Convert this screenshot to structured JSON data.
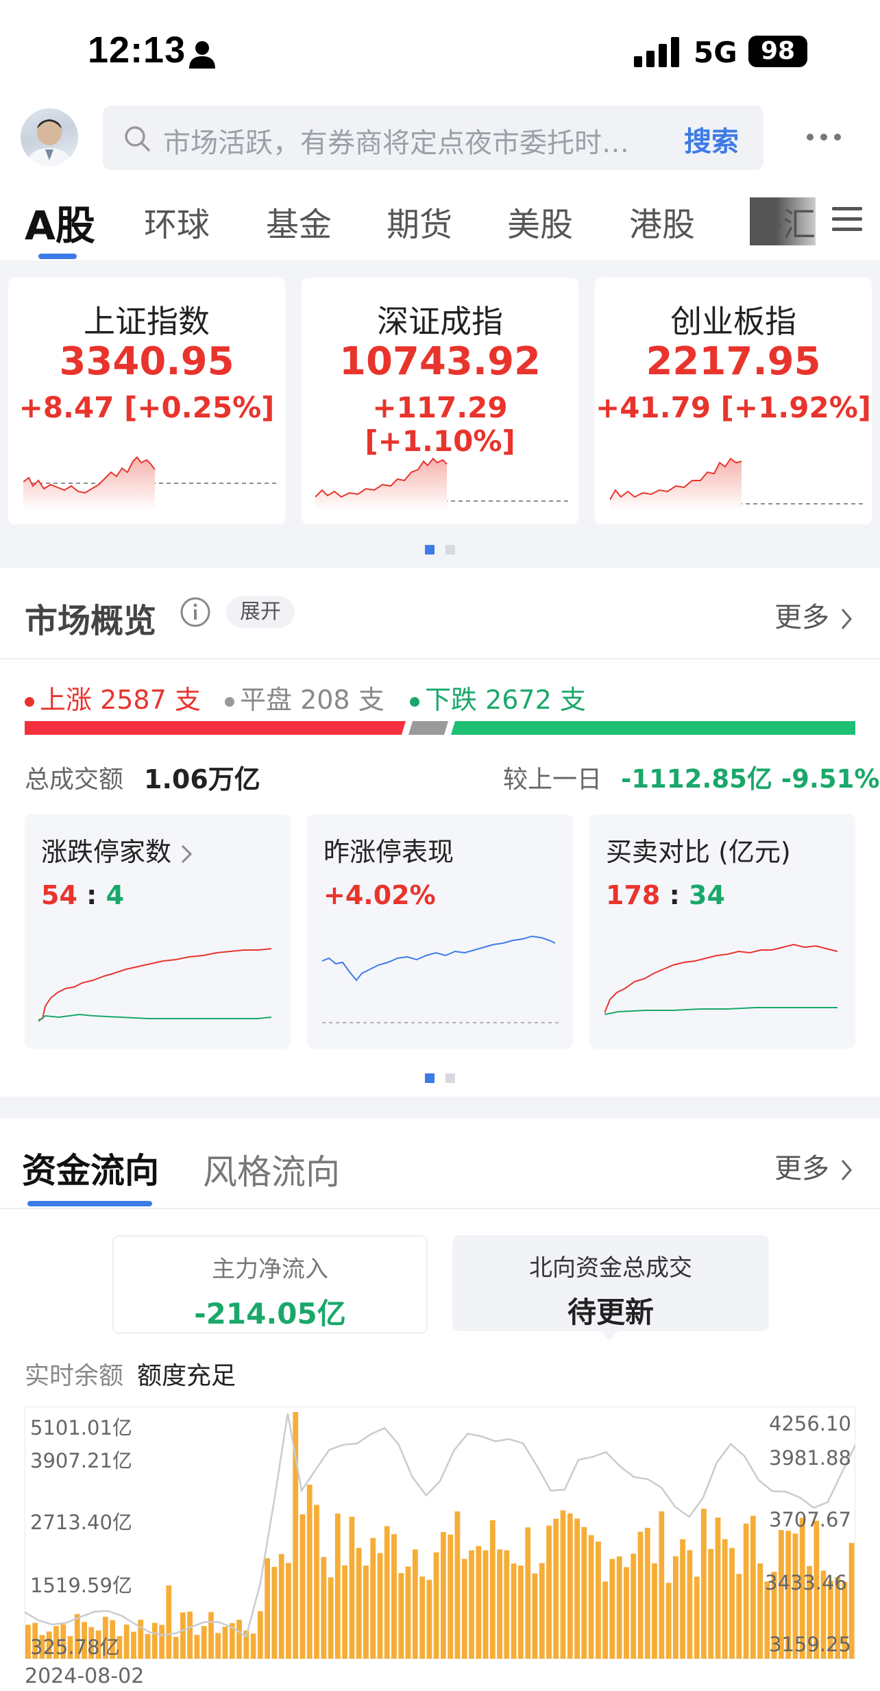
{
  "status_bar": {
    "time": "12:13",
    "network": "5G",
    "battery": "98"
  },
  "header": {
    "search_placeholder": "市场活跃，有券商将定点夜市委托时…",
    "search_button": "搜索",
    "more_icon": "ellipsis-icon"
  },
  "tabs": [
    "A股",
    "环球",
    "基金",
    "期货",
    "美股",
    "港股",
    "外汇"
  ],
  "indices": [
    {
      "name": "上证指数",
      "value": "3340.95",
      "change": "+8.47 [+0.25%]"
    },
    {
      "name": "深证成指",
      "value": "10743.92",
      "change": "+117.29 [+1.10%]"
    },
    {
      "name": "创业板指",
      "value": "2217.95",
      "change": "+41.79 [+1.92%]"
    }
  ],
  "overview": {
    "title": "市场概览",
    "expand": "展开",
    "more": "更多",
    "up_label": "上涨 2587 支",
    "flat_label": "平盘 208 支",
    "down_label": "下跌 2672 支",
    "up_count": 2587,
    "flat_count": 208,
    "down_count": 2672,
    "turnover_label": "总成交额",
    "turnover_value": "1.06万亿",
    "compare_label": "较上一日",
    "compare_value": "-1112.85亿 -9.51%",
    "mini_cards": [
      {
        "title": "涨跌停家数",
        "v1": "54",
        "sep": ":",
        "v2": "4"
      },
      {
        "title": "昨涨停表现",
        "v1": "+4.02%"
      },
      {
        "title": "买卖对比 (亿元)",
        "v1": "178",
        "sep": ":",
        "v2": "34"
      }
    ]
  },
  "flow": {
    "tab_active": "资金流向",
    "tab_other": "风格流向",
    "more": "更多",
    "main_inflow_label": "主力净流入",
    "main_inflow_value": "-214.05亿",
    "north_label": "北向资金总成交",
    "north_value": "待更新",
    "quota_label": "实时余额",
    "quota_value": "额度充足",
    "left_axis": [
      "5101.01亿",
      "3907.21亿",
      "2713.40亿",
      "1519.59亿",
      "325.78亿"
    ],
    "right_axis": [
      "4256.10",
      "3981.88",
      "3707.67",
      "3433.46",
      "3159.25"
    ],
    "date": "2024-08-02"
  },
  "colors": {
    "up": "#e8342c",
    "down": "#1aa86a",
    "accent": "#3d7be6",
    "bar": "#f6ad37"
  }
}
